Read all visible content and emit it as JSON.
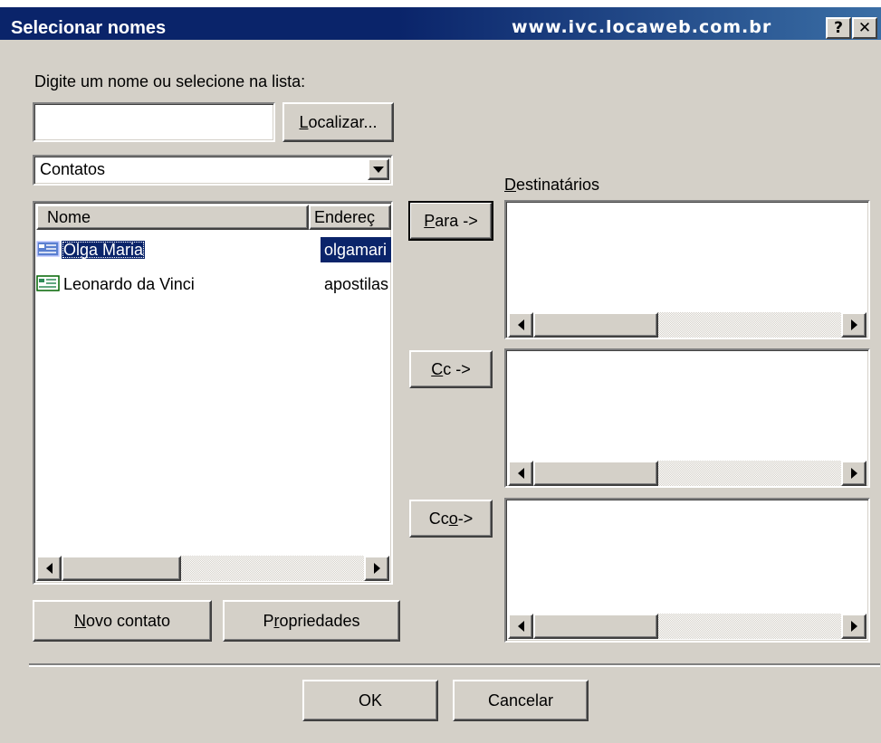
{
  "window": {
    "title": "Selecionar nomes",
    "url_text": "www.ivc.locaweb.com.br",
    "help_button": "?",
    "close_button": "✕",
    "active_title_color": "#0a246a"
  },
  "search": {
    "prompt": "Digite um nome ou selecione na lista:",
    "value": "",
    "find_button_prefix": "L",
    "find_button_rest": "ocalizar..."
  },
  "source": {
    "selected": "Contatos"
  },
  "contacts": {
    "columns": [
      "Nome",
      "Endereç"
    ],
    "rows": [
      {
        "name": "Olga Maria",
        "address": "olgamari",
        "selected": true,
        "icon": "contact-card-icon"
      },
      {
        "name": "Leonardo da Vinci",
        "address": "apostilas",
        "selected": false,
        "icon": "contact-card-icon"
      }
    ]
  },
  "actions": {
    "new_contact_prefix": "N",
    "new_contact_rest": "ovo contato",
    "properties_pre": "P",
    "properties_u": "r",
    "properties_rest": "opriedades"
  },
  "recipients": {
    "label_prefix": "D",
    "label_rest": "estinatários",
    "to_prefix": "P",
    "to_rest": "ara ->",
    "cc_prefix": "C",
    "cc_rest": "c ->",
    "bcc_pre": "Cc",
    "bcc_u": "o",
    "bcc_rest": " ->"
  },
  "footer": {
    "ok_label": "OK",
    "cancel_label": "Cancelar"
  }
}
